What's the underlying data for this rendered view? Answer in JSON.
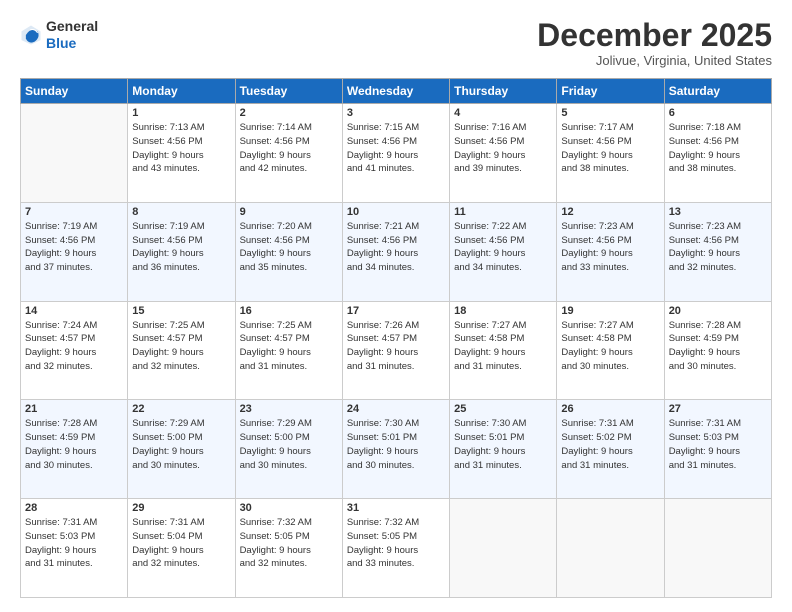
{
  "header": {
    "logo_line1": "General",
    "logo_line2": "Blue",
    "month": "December 2025",
    "location": "Jolivue, Virginia, United States"
  },
  "weekdays": [
    "Sunday",
    "Monday",
    "Tuesday",
    "Wednesday",
    "Thursday",
    "Friday",
    "Saturday"
  ],
  "weeks": [
    [
      {
        "day": "",
        "info": ""
      },
      {
        "day": "1",
        "info": "Sunrise: 7:13 AM\nSunset: 4:56 PM\nDaylight: 9 hours\nand 43 minutes."
      },
      {
        "day": "2",
        "info": "Sunrise: 7:14 AM\nSunset: 4:56 PM\nDaylight: 9 hours\nand 42 minutes."
      },
      {
        "day": "3",
        "info": "Sunrise: 7:15 AM\nSunset: 4:56 PM\nDaylight: 9 hours\nand 41 minutes."
      },
      {
        "day": "4",
        "info": "Sunrise: 7:16 AM\nSunset: 4:56 PM\nDaylight: 9 hours\nand 39 minutes."
      },
      {
        "day": "5",
        "info": "Sunrise: 7:17 AM\nSunset: 4:56 PM\nDaylight: 9 hours\nand 38 minutes."
      },
      {
        "day": "6",
        "info": "Sunrise: 7:18 AM\nSunset: 4:56 PM\nDaylight: 9 hours\nand 38 minutes."
      }
    ],
    [
      {
        "day": "7",
        "info": "Sunrise: 7:19 AM\nSunset: 4:56 PM\nDaylight: 9 hours\nand 37 minutes."
      },
      {
        "day": "8",
        "info": "Sunrise: 7:19 AM\nSunset: 4:56 PM\nDaylight: 9 hours\nand 36 minutes."
      },
      {
        "day": "9",
        "info": "Sunrise: 7:20 AM\nSunset: 4:56 PM\nDaylight: 9 hours\nand 35 minutes."
      },
      {
        "day": "10",
        "info": "Sunrise: 7:21 AM\nSunset: 4:56 PM\nDaylight: 9 hours\nand 34 minutes."
      },
      {
        "day": "11",
        "info": "Sunrise: 7:22 AM\nSunset: 4:56 PM\nDaylight: 9 hours\nand 34 minutes."
      },
      {
        "day": "12",
        "info": "Sunrise: 7:23 AM\nSunset: 4:56 PM\nDaylight: 9 hours\nand 33 minutes."
      },
      {
        "day": "13",
        "info": "Sunrise: 7:23 AM\nSunset: 4:56 PM\nDaylight: 9 hours\nand 32 minutes."
      }
    ],
    [
      {
        "day": "14",
        "info": "Sunrise: 7:24 AM\nSunset: 4:57 PM\nDaylight: 9 hours\nand 32 minutes."
      },
      {
        "day": "15",
        "info": "Sunrise: 7:25 AM\nSunset: 4:57 PM\nDaylight: 9 hours\nand 32 minutes."
      },
      {
        "day": "16",
        "info": "Sunrise: 7:25 AM\nSunset: 4:57 PM\nDaylight: 9 hours\nand 31 minutes."
      },
      {
        "day": "17",
        "info": "Sunrise: 7:26 AM\nSunset: 4:57 PM\nDaylight: 9 hours\nand 31 minutes."
      },
      {
        "day": "18",
        "info": "Sunrise: 7:27 AM\nSunset: 4:58 PM\nDaylight: 9 hours\nand 31 minutes."
      },
      {
        "day": "19",
        "info": "Sunrise: 7:27 AM\nSunset: 4:58 PM\nDaylight: 9 hours\nand 30 minutes."
      },
      {
        "day": "20",
        "info": "Sunrise: 7:28 AM\nSunset: 4:59 PM\nDaylight: 9 hours\nand 30 minutes."
      }
    ],
    [
      {
        "day": "21",
        "info": "Sunrise: 7:28 AM\nSunset: 4:59 PM\nDaylight: 9 hours\nand 30 minutes."
      },
      {
        "day": "22",
        "info": "Sunrise: 7:29 AM\nSunset: 5:00 PM\nDaylight: 9 hours\nand 30 minutes."
      },
      {
        "day": "23",
        "info": "Sunrise: 7:29 AM\nSunset: 5:00 PM\nDaylight: 9 hours\nand 30 minutes."
      },
      {
        "day": "24",
        "info": "Sunrise: 7:30 AM\nSunset: 5:01 PM\nDaylight: 9 hours\nand 30 minutes."
      },
      {
        "day": "25",
        "info": "Sunrise: 7:30 AM\nSunset: 5:01 PM\nDaylight: 9 hours\nand 31 minutes."
      },
      {
        "day": "26",
        "info": "Sunrise: 7:31 AM\nSunset: 5:02 PM\nDaylight: 9 hours\nand 31 minutes."
      },
      {
        "day": "27",
        "info": "Sunrise: 7:31 AM\nSunset: 5:03 PM\nDaylight: 9 hours\nand 31 minutes."
      }
    ],
    [
      {
        "day": "28",
        "info": "Sunrise: 7:31 AM\nSunset: 5:03 PM\nDaylight: 9 hours\nand 31 minutes."
      },
      {
        "day": "29",
        "info": "Sunrise: 7:31 AM\nSunset: 5:04 PM\nDaylight: 9 hours\nand 32 minutes."
      },
      {
        "day": "30",
        "info": "Sunrise: 7:32 AM\nSunset: 5:05 PM\nDaylight: 9 hours\nand 32 minutes."
      },
      {
        "day": "31",
        "info": "Sunrise: 7:32 AM\nSunset: 5:05 PM\nDaylight: 9 hours\nand 33 minutes."
      },
      {
        "day": "",
        "info": ""
      },
      {
        "day": "",
        "info": ""
      },
      {
        "day": "",
        "info": ""
      }
    ]
  ]
}
